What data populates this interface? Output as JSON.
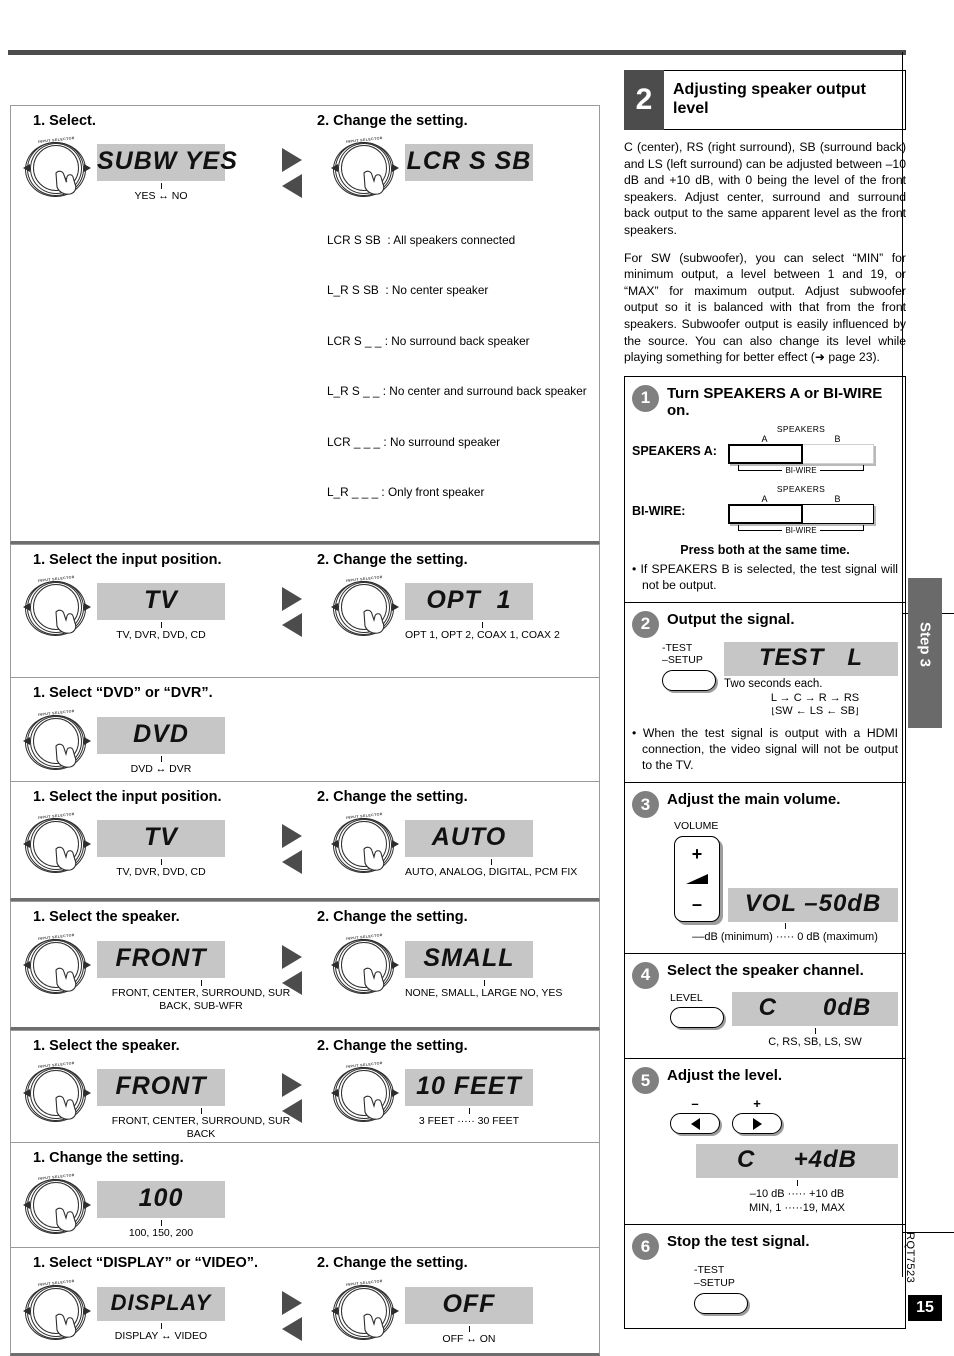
{
  "page": {
    "number": "15",
    "doc_code": "RQT7523",
    "side_tab": "Step 3"
  },
  "left_column": {
    "blocks": [
      {
        "id": "subwoofer",
        "head1": "1. Select.",
        "head2": "2. Change the setting.",
        "knob_label": "INPUT SELECTOR",
        "display1": "SUBW YES",
        "caption1": "YES ↔ NO",
        "display2": "LCR S SB",
        "option_list": [
          "LCR S SB  : All speakers connected",
          "L_R S SB  : No center speaker",
          "LCR S _ _ : No surround back speaker",
          "L_R S _ _ : No center and surround back speaker",
          "LCR _ _ _ : No surround speaker",
          "L_R _ _ _ : Only front speaker"
        ]
      },
      {
        "id": "digital-input",
        "head1": "1. Select the input position.",
        "head2": "2. Change the setting.",
        "knob_label": "INPUT SELECTOR",
        "display1": "TV",
        "caption1": "TV, DVR, DVD, CD",
        "display2": "OPT  1",
        "caption2": "OPT 1, OPT 2,\nCOAX 1, COAX 2"
      },
      {
        "id": "dvd-dvr",
        "head1": "1. Select “DVD” or “DVR”.",
        "head2": "",
        "knob_label": "INPUT SELECTOR",
        "display1": "DVD",
        "caption1": "DVD ↔ DVR"
      },
      {
        "id": "input-mode",
        "head1": "1. Select the input position.",
        "head2": "2. Change the setting.",
        "knob_label": "INPUT SELECTOR",
        "display1": "TV",
        "caption1": "TV, DVR, DVD, CD",
        "display2": "AUTO",
        "caption2": "AUTO, ANALOG,\nDIGITAL, PCM FIX"
      },
      {
        "id": "speaker-size",
        "head1": "1. Select the speaker.",
        "head2": "2. Change the setting.",
        "knob_label": "INPUT SELECTOR",
        "display1": "FRONT",
        "caption1": "FRONT, CENTER,\nSURROUND,\nSUR BACK, SUB-WFR",
        "display2": "SMALL",
        "caption2": "NONE, SMALL, LARGE\nNO, YES"
      },
      {
        "id": "speaker-distance",
        "head1": "1. Select the speaker.",
        "head2": "2. Change the setting.",
        "knob_label": "INPUT SELECTOR",
        "display1": "FRONT",
        "caption1": "FRONT, CENTER,\nSURROUND,\nSUR BACK",
        "display2": "10 FEET",
        "caption2": "3 FEET ····· 30 FEET"
      },
      {
        "id": "crossover",
        "head1": "1. Change the setting.",
        "head2": "",
        "knob_label": "INPUT SELECTOR",
        "display1": "100",
        "caption1": "100, 150, 200"
      },
      {
        "id": "display-video",
        "head1": "1. Select “DISPLAY” or “VIDEO”.",
        "head2": "2. Change the setting.",
        "knob_label": "INPUT SELECTOR",
        "display1": "DISPLAY",
        "caption1": "DISPLAY ↔ VIDEO",
        "display2": "OFF",
        "caption2": "OFF ↔ ON"
      }
    ]
  },
  "right_column": {
    "section": {
      "number": "2",
      "title": "Adjusting speaker output level"
    },
    "intro": {
      "paragraph1": "C (center), RS (right surround), SB (surround back) and LS (left surround) can be adjusted between –10 dB and +10 dB, with 0 being the level of the front speakers. Adjust center, surround and surround back output to the same apparent level as the front speakers.",
      "paragraph2": "For SW (subwoofer), you can select “MIN” for minimum output, a level between 1 and 19, or “MAX” for maximum output. Adjust subwoofer output so it is balanced with that from the front speakers. Subwoofer output is easily influenced by the source. You can also change its level while playing something for better effect (➜ page 23)."
    },
    "steps": [
      {
        "number": "1",
        "title": "Turn SPEAKERS A or BI-WIRE on.",
        "diagram": {
          "speakers_caption": "SPEAKERS",
          "label_a": "A",
          "label_b": "B",
          "row1_label": "SPEAKERS A:",
          "row2_label": "BI-WIRE:",
          "biwire_caption": "BI-WIRE"
        },
        "press_both": "Press both at the same time.",
        "bullet": "• If SPEAKERS B is selected, the test signal will not be output."
      },
      {
        "number": "2",
        "title": "Output the signal.",
        "button_label": "-TEST\n–SETUP",
        "display": "TEST   L",
        "note": "Two seconds each.",
        "flow_line1": "L → C → R → RS",
        "flow_line2": "SW ← LS ← SB",
        "bullet": "• When the test signal is output with a HDMI connection, the video signal will not be output to the TV."
      },
      {
        "number": "3",
        "title": "Adjust the main volume.",
        "button_label": "VOLUME",
        "plus": "+",
        "minus": "–",
        "display": "VOL –50dB",
        "caption": "––dB (minimum) ····· 0 dB (maximum)"
      },
      {
        "number": "4",
        "title": "Select the speaker channel.",
        "button_label": "LEVEL",
        "display": "C      0dB",
        "caption": "C, RS, SB, LS, SW"
      },
      {
        "number": "5",
        "title": "Adjust the level.",
        "minus": "–",
        "plus": "+",
        "display": "C     +4dB",
        "caption_line1": "–10 dB ····· +10 dB",
        "caption_line2": "MIN, 1 ·····19, MAX"
      },
      {
        "number": "6",
        "title": "Stop the test signal.",
        "button_label": "-TEST\n–SETUP"
      }
    ]
  },
  "colors": {
    "lcd_bg": "#c6c6c6",
    "rule": "#4c4c4c",
    "badge": "#808080",
    "tab": "#6a6a6a"
  }
}
